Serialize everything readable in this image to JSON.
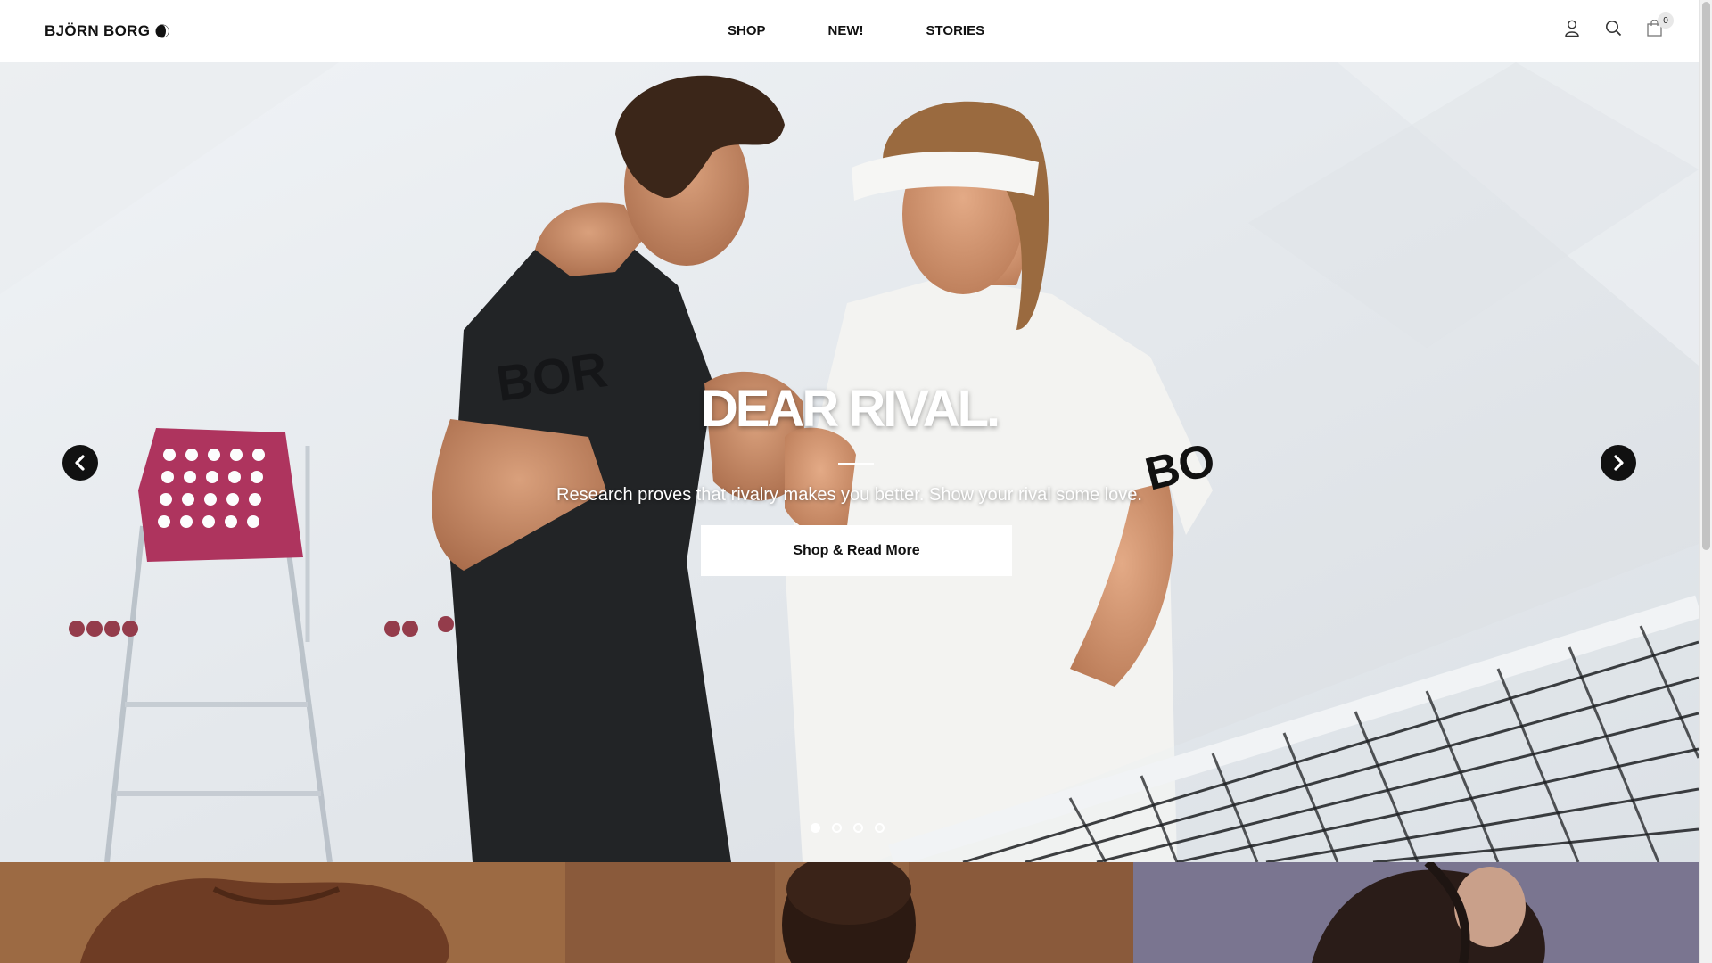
{
  "header": {
    "logo_text": "BJÖRN BORG",
    "nav": [
      {
        "label": "SHOP"
      },
      {
        "label": "NEW!"
      },
      {
        "label": "STORIES"
      }
    ],
    "icons": {
      "account": "user-icon",
      "search": "search-icon",
      "cart": "shopping-bag-icon"
    },
    "cart_count": "0"
  },
  "hero": {
    "title": "DEAR RIVAL.",
    "subtitle": "Research proves that rivalry makes you better. Show your rival some love.",
    "cta_label": "Shop & Read More",
    "shirt_print_left": "BOR",
    "shirt_print_right": "BO",
    "slides_total": 4,
    "active_slide": 1,
    "prev_icon": "chevron-left-icon",
    "next_icon": "chevron-right-icon"
  },
  "colors": {
    "accent": "#111111",
    "background": "#ffffff",
    "chair": "#a8214f"
  }
}
